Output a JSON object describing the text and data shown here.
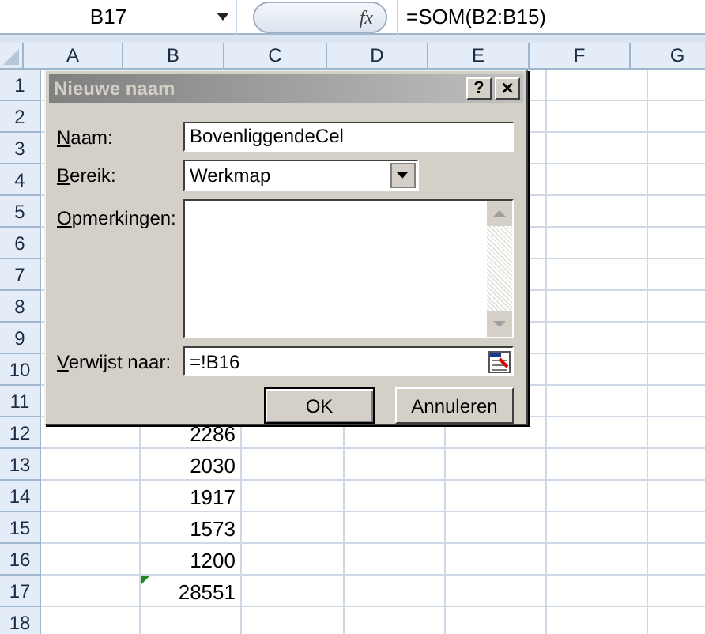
{
  "formula_bar": {
    "name_box": "B17",
    "fx": "fx",
    "formula": "=SOM(B2:B15)"
  },
  "columns": [
    "A",
    "B",
    "C",
    "D",
    "E",
    "F",
    "G"
  ],
  "rows": [
    {
      "number": "1",
      "b": ""
    },
    {
      "number": "2",
      "b": ""
    },
    {
      "number": "3",
      "b": ""
    },
    {
      "number": "4",
      "b": ""
    },
    {
      "number": "5",
      "b": ""
    },
    {
      "number": "6",
      "b": ""
    },
    {
      "number": "7",
      "b": ""
    },
    {
      "number": "8",
      "b": ""
    },
    {
      "number": "9",
      "b": ""
    },
    {
      "number": "10",
      "b": ""
    },
    {
      "number": "11",
      "b": ""
    },
    {
      "number": "12",
      "b": "2286"
    },
    {
      "number": "13",
      "b": "2030"
    },
    {
      "number": "14",
      "b": "1917"
    },
    {
      "number": "15",
      "b": "1573"
    },
    {
      "number": "16",
      "b": "1200"
    },
    {
      "number": "17",
      "b": "28551",
      "error_marker": true
    },
    {
      "number": "18",
      "b": ""
    }
  ],
  "dialog": {
    "title": "Nieuwe naam",
    "help": "?",
    "close": "×",
    "name_label": "Naam:",
    "name_value": "BovenliggendeCel",
    "scope_label": "Bereik:",
    "scope_value": "Werkmap",
    "comments_label": "Opmerkingen:",
    "refers_label": "Verwijst naar:",
    "refers_value": "=!B16",
    "ok": "OK",
    "cancel": "Annuleren"
  }
}
